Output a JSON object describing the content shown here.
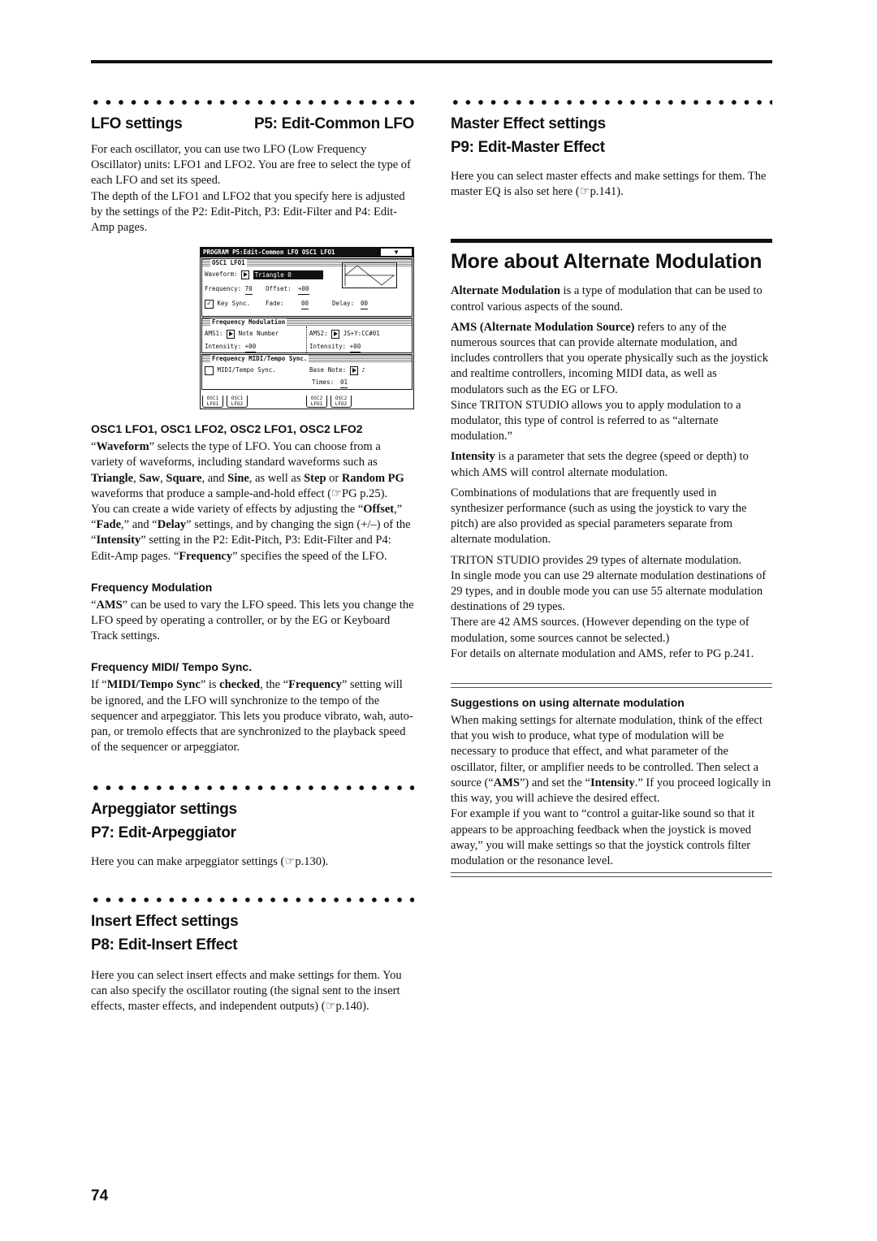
{
  "page_number": "74",
  "left": {
    "lfo": {
      "title_left": "LFO settings",
      "title_right": "P5: Edit-Common LFO",
      "p1": "For each oscillator, you can use two LFO (Low Frequency Oscillator) units: LFO1 and LFO2. You are free to select the type of each LFO and set its speed.",
      "p2": "The depth of the LFO1 and LFO2 that you specify here is adjusted by the settings of the P2: Edit-Pitch, P3: Edit-Filter and P4: Edit-Amp pages."
    },
    "lcd": {
      "header": "PROGRAM P5:Edit-Common LFO   OSC1 LFO1",
      "dropdown_icon": "▼",
      "box1_title": "OSC1 LFO1",
      "waveform_label": "Waveform:",
      "waveform_value": "Triangle 0",
      "frequency_label": "Frequency:",
      "frequency_value": "70",
      "offset_label": "Offset:",
      "offset_value": "+00",
      "key_sync_label": "Key Sync.",
      "key_sync_checked": true,
      "fade_label": "Fade:",
      "fade_value": "00",
      "delay_label": "Delay:",
      "delay_value": "00",
      "box2_title": "Frequency Modulation",
      "ams1_label": "AMS1:",
      "ams1_value": "Note Number",
      "ams2_label": "AMS2:",
      "ams2_value": "JS+Y:CC#01",
      "intensity1_label": "Intensity:",
      "intensity1_value": "+00",
      "intensity2_label": "Intensity:",
      "intensity2_value": "+00",
      "box3_title": "Frequency MIDI/Tempo Sync.",
      "midi_sync_label": "MIDI/Tempo Sync.",
      "midi_sync_checked": false,
      "base_note_label": "Base Note:",
      "base_note_value": "♪",
      "times_label": "Times:",
      "times_value": "01",
      "tabs": [
        {
          "line1": "OSC1",
          "line2": "LFO1"
        },
        {
          "line1": "OSC1",
          "line2": "LFO2"
        },
        {
          "line1": "OSC2",
          "line2": "LFO1"
        },
        {
          "line1": "OSC2",
          "line2": "LFO2"
        }
      ]
    },
    "osc_heading": "OSC1 LFO1, OSC1 LFO2, OSC2 LFO1, OSC2 LFO2",
    "waveform_para": {
      "q1": "“",
      "b1": "Waveform",
      "t1": "” selects the type of LFO. You can choose from a variety of waveforms, including standard waveforms such as ",
      "b2": "Triangle",
      "t2": ", ",
      "b3": "Saw",
      "t3": ", ",
      "b4": "Square",
      "t4": ", and ",
      "b5": "Sine",
      "t5": ", as well as ",
      "b6": "Step",
      "t6": " or ",
      "b7": "Random PG",
      "t7": " waveforms that produce a sample-and-hold effect (☞PG p.25)."
    },
    "effects_para": {
      "t0": "You can create a wide variety of effects by adjusting the “",
      "b1": "Offset",
      "t1": ",” “",
      "b2": "Fade",
      "t2": ",” and “",
      "b3": "Delay",
      "t3": "” settings, and by changing the sign (+/–) of the “",
      "b4": "Intensity",
      "t4": "” setting in the P2: Edit-Pitch, P3: Edit-Filter and P4: Edit-Amp pages. “",
      "b5": "Frequency",
      "t5": "” specifies the speed of the LFO."
    },
    "freq_mod": {
      "heading": "Frequency Modulation",
      "t0": "“",
      "b1": "AMS",
      "t1": "” can be used to vary the LFO speed. This lets you change the LFO speed by operating a controller, or by the EG or Keyboard Track settings."
    },
    "freq_sync": {
      "heading": "Frequency MIDI/ Tempo Sync.",
      "t0": "If “",
      "b1": "MIDI/Tempo Sync",
      "t1": "” is ",
      "b2": "checked",
      "t2": ", the “",
      "b3": "Frequency",
      "t3": "” setting will be ignored, and the LFO will synchronize to the tempo of the sequencer and arpeggiator. This lets you produce vibrato, wah, auto-pan, or tremolo effects that are synchronized to the playback speed of the sequencer or arpeggiator."
    },
    "arp": {
      "title1": "Arpeggiator settings",
      "title2": "P7: Edit-Arpeggiator",
      "body": "Here you can make arpeggiator settings (☞p.130)."
    },
    "insert": {
      "title1": "Insert Effect settings",
      "title2": "P8: Edit-Insert Effect",
      "body": "Here you can select insert effects and make settings for them. You can also specify the oscillator routing (the signal sent to the insert effects, master effects, and independent outputs) (☞p.140)."
    }
  },
  "right": {
    "master": {
      "title1": "Master Effect settings",
      "title2": "P9: Edit-Master Effect",
      "body": "Here you can select master effects and make settings for them. The master EQ is also set here (☞p.141)."
    },
    "alt_mod": {
      "title": "More about Alternate Modulation",
      "p1_b": "Alternate Modulation",
      "p1_t": " is a type of modulation that can be used to control various aspects of the sound.",
      "p2_b": "AMS (Alternate Modulation Source)",
      "p2_t": " refers to any of the numerous sources that can provide alternate modulation, and includes controllers that you operate physically such as the joystick and realtime controllers, incoming MIDI data, as well as modulators such as the EG or LFO.",
      "p3": "Since TRITON STUDIO allows you to apply modulation to a modulator, this type of control is referred to as “alternate modulation.”",
      "p4_b": "Intensity",
      "p4_t": " is a parameter that sets the degree (speed or depth) to which AMS will control alternate modulation.",
      "p5": "Combinations of modulations that are frequently used in synthesizer performance (such as using the joystick to vary the pitch) are also provided as special parameters separate from alternate modulation.",
      "p6": "TRITON STUDIO provides 29 types of alternate modulation.",
      "p7": "In single mode you can use 29 alternate modulation destinations of 29 types, and in double mode you can use 55 alternate modulation destinations of 29 types.",
      "p8": "There are 42 AMS sources. (However depending on the type of modulation, some sources cannot be selected.)",
      "p9": "For details on alternate modulation and AMS, refer to PG p.241."
    },
    "suggestions": {
      "heading": "Suggestions on using alternate modulation",
      "t0": "When making settings for alternate modulation, think of the effect that you wish to produce, what type of modulation will be necessary to produce that effect, and what parameter of the oscillator, filter, or amplifier needs to be controlled. Then select a source (“",
      "b1": "AMS",
      "t1": "”) and set the “",
      "b2": "Intensity",
      "t2": ".” If you proceed logically in this way, you will achieve the desired effect.",
      "p2": "For example if you want to “control a guitar-like sound so that it appears to be approaching feedback when the joystick is moved away,” you will make settings so that the joystick controls filter modulation or the resonance level."
    }
  }
}
